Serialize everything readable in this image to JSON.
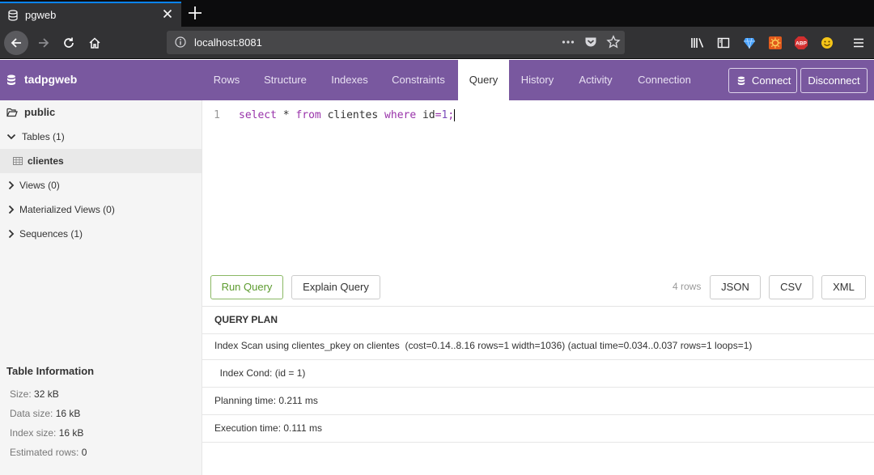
{
  "browser": {
    "tab_title": "pgweb",
    "url": "localhost:8081"
  },
  "header": {
    "brand": "tadpgweb",
    "tabs": [
      {
        "label": "Rows"
      },
      {
        "label": "Structure"
      },
      {
        "label": "Indexes"
      },
      {
        "label": "Constraints"
      },
      {
        "label": "Query"
      },
      {
        "label": "History"
      },
      {
        "label": "Activity"
      },
      {
        "label": "Connection"
      }
    ],
    "active_tab": "Query",
    "connect_label": "Connect",
    "disconnect_label": "Disconnect"
  },
  "sidebar": {
    "schema": "public",
    "tables_label": "Tables (1)",
    "table_item": "clientes",
    "views_label": "Views (0)",
    "matviews_label": "Materialized Views (0)",
    "sequences_label": "Sequences (1)",
    "table_info": {
      "title": "Table Information",
      "size_key": "Size:",
      "size_val": "32 kB",
      "data_key": "Data size:",
      "data_val": "16 kB",
      "index_key": "Index size:",
      "index_val": "16 kB",
      "rows_key": "Estimated rows:",
      "rows_val": "0"
    }
  },
  "editor": {
    "line_number": "1",
    "tokens": {
      "select": "select",
      "star": " * ",
      "from": "from",
      "table": " clientes ",
      "where": "where",
      "col": " id",
      "eq": "=",
      "num": "1",
      "semi": ";"
    }
  },
  "actions": {
    "run_query": "Run Query",
    "explain_query": "Explain Query",
    "rows_count": "4 rows",
    "json": "JSON",
    "csv": "CSV",
    "xml": "XML"
  },
  "results": {
    "header": "QUERY PLAN",
    "rows": [
      "Index Scan using clientes_pkey on clientes  (cost=0.14..8.16 rows=1 width=1036) (actual time=0.034..0.037 rows=1 loops=1)",
      "  Index Cond: (id = 1)",
      "Planning time: 0.211 ms",
      "Execution time: 0.111 ms"
    ]
  },
  "colors": {
    "header_bg": "#79589f",
    "run_query_green": "#5c9b2e",
    "browser_bg": "#323234"
  }
}
